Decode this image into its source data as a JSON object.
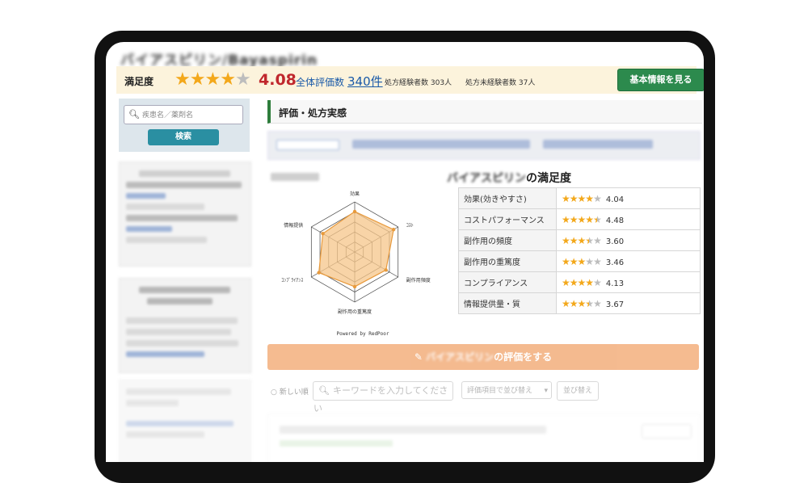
{
  "header": {
    "drug_title_blurred": "バイアスピリン/Bayaspirin"
  },
  "satisfaction": {
    "label": "満足度",
    "stars": 4,
    "max_stars": 5,
    "score": "4.08",
    "total_reviews_label": "全体評価数",
    "total_reviews_count": "340件",
    "experienced_label": "処方経験者数 303人",
    "unexperienced_label": "処方未経験者数 37人",
    "info_button": "基本情報を見る"
  },
  "sidebar": {
    "search_placeholder": "疾患名／薬剤名",
    "search_button": "検索"
  },
  "main": {
    "section_title": "評価・処方実感",
    "drug_satisfaction_suffix": "の満足度",
    "drug_name_blurred": "バイアスピリン",
    "ratings": [
      {
        "label": "効果(効きやすさ)",
        "value": "4.04",
        "stars": 4
      },
      {
        "label": "コストパフォーマンス",
        "value": "4.48",
        "stars": 4.5
      },
      {
        "label": "副作用の頻度",
        "value": "3.60",
        "stars": 3.5
      },
      {
        "label": "副作用の重篤度",
        "value": "3.46",
        "stars": 3
      },
      {
        "label": "コンプライアンス",
        "value": "4.13",
        "stars": 4
      },
      {
        "label": "情報提供量・質",
        "value": "3.67",
        "stars": 3.5
      }
    ],
    "radar": {
      "axes": [
        "効果",
        "コストパフォーマンス",
        "副作用の頻度",
        "副作用の重篤度",
        "コンプライアンス",
        "情報提供量・質"
      ],
      "axis_labels_visible": [
        "効果",
        "ｺｽﾄ",
        "副作用頻度",
        "副作用の重篤度",
        "ｺﾝﾌﾟﾗｲｱﾝｽ",
        "情報提供"
      ],
      "values": [
        4.04,
        4.48,
        3.6,
        3.46,
        4.13,
        3.67
      ],
      "max": 5,
      "fill_color": "#f6c58a",
      "stroke_color": "#e89a3c",
      "powered_by": "Powered by RedPoor"
    },
    "review_button_suffix": "の評価をする",
    "filters": {
      "newest_label": "新しい順",
      "keyword_placeholder": "キーワードを入力してください",
      "sort_select": "評価項目で並び替え",
      "sort_button": "並び替え"
    }
  }
}
